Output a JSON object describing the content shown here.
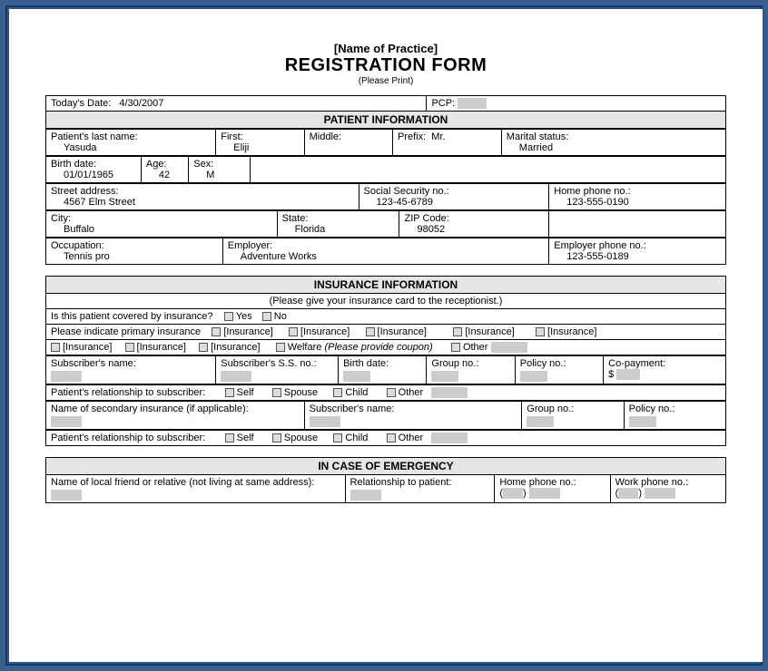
{
  "header": {
    "practice": "[Name of Practice]",
    "title": "REGISTRATION FORM",
    "please_print": "(Please Print)"
  },
  "meta": {
    "date_label": "Today's Date:",
    "date_value": "4/30/2007",
    "pcp_label": "PCP:"
  },
  "patient_section": {
    "title": "PATIENT INFORMATION",
    "last_label": "Patient's last name:",
    "last_value": "Yasuda",
    "first_label": "First:",
    "first_value": "Eliji",
    "middle_label": "Middle:",
    "prefix_label": "Prefix:",
    "prefix_value": "Mr.",
    "marital_label": "Marital status:",
    "marital_value": "Married",
    "birth_label": "Birth date:",
    "birth_value": "01/01/1965",
    "age_label": "Age:",
    "age_value": "42",
    "sex_label": "Sex:",
    "sex_value": "M",
    "street_label": "Street address:",
    "street_value": "4567 Elm Street",
    "ssn_label": "Social Security no.:",
    "ssn_value": "123-45-6789",
    "home_phone_label": "Home phone no.:",
    "home_phone_value": "123-555-0190",
    "city_label": "City:",
    "city_value": "Buffalo",
    "state_label": "State:",
    "state_value": "Florida",
    "zip_label": "ZIP Code:",
    "zip_value": "98052",
    "occ_label": "Occupation:",
    "occ_value": "Tennis pro",
    "emp_label": "Employer:",
    "emp_value": "Adventure Works",
    "emp_phone_label": "Employer phone no.:",
    "emp_phone_value": "123-555-0189"
  },
  "insurance_section": {
    "title": "INSURANCE INFORMATION",
    "note": "(Please give your insurance card to the receptionist.)",
    "covered_q": "Is this patient covered by insurance?",
    "yes": "Yes",
    "no": "No",
    "primary_q": "Please indicate primary insurance",
    "insurance_opt": "[Insurance]",
    "welfare": "Welfare",
    "welfare_note": "(Please provide coupon)",
    "other": "Other",
    "sub_name": "Subscriber's name:",
    "sub_ssn": "Subscriber's S.S. no.:",
    "birth": "Birth date:",
    "group": "Group no.:",
    "policy": "Policy no.:",
    "copay": "Co-payment:",
    "dollar": "$",
    "rel_q": "Patient's relationship to subscriber:",
    "self": "Self",
    "spouse": "Spouse",
    "child": "Child",
    "secondary_name": "Name of secondary insurance (if applicable):"
  },
  "emergency_section": {
    "title": "IN CASE OF EMERGENCY",
    "friend_label": "Name of local friend or relative (not living at same address):",
    "rel_label": "Relationship to patient:",
    "home_label": "Home phone no.:",
    "work_label": "Work phone no.:",
    "paren_open": "(",
    "paren_close": ")"
  }
}
